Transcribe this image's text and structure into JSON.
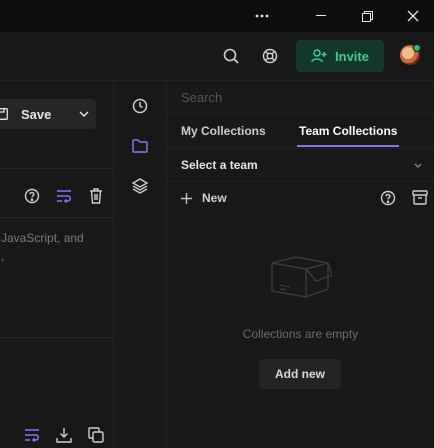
{
  "titlebar": {
    "more_icon": "more-horizontal-icon",
    "minimize_icon": "minimize-icon",
    "restore_icon": "restore-icon",
    "close_icon": "close-icon"
  },
  "header": {
    "search_icon": "search-icon",
    "support_icon": "lifebuoy-icon",
    "invite_label": "Invite",
    "invite_icon": "add-user-icon",
    "accent_color": "#42c98f"
  },
  "left_pane": {
    "save_label": "Save",
    "toolbar_icons": [
      "help-circle-icon",
      "wrap-lines-icon",
      "trash-icon"
    ],
    "text_line1": "JavaScript, and",
    "text_line2": ",",
    "bottom_icons": [
      "wrap-lines-icon",
      "download-icon",
      "copy-icon"
    ]
  },
  "rail": {
    "icons": [
      "history-icon",
      "folder-icon",
      "layers-icon"
    ],
    "active_index": 1,
    "active_color": "#7c7cf0"
  },
  "collections": {
    "search_placeholder": "Search",
    "tabs": [
      {
        "label": "My Collections",
        "active": false
      },
      {
        "label": "Team Collections",
        "active": true
      }
    ],
    "team_select_label": "Select a team",
    "new_label": "New",
    "empty_text": "Collections are empty",
    "add_new_label": "Add new"
  }
}
